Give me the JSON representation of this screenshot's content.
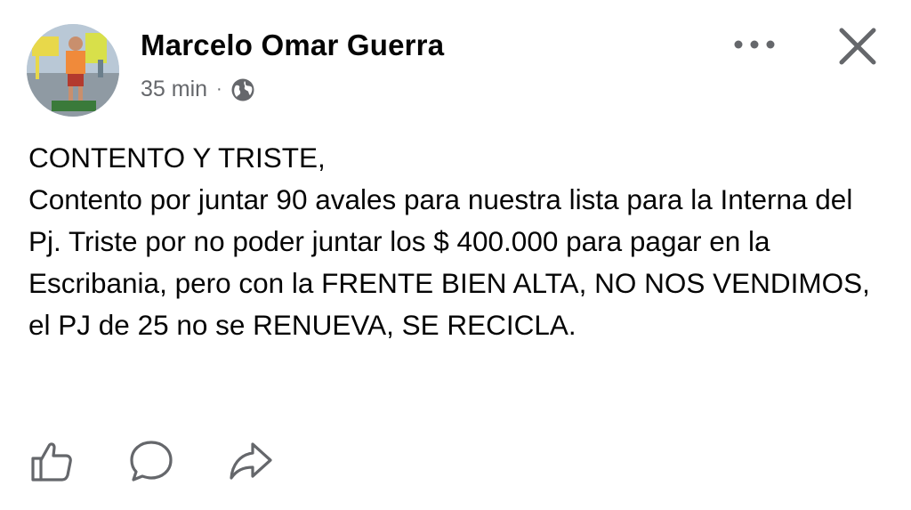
{
  "post": {
    "author_name": "Marcelo Omar Guerra",
    "timestamp": "35 min",
    "separator": "·",
    "privacy_icon": "globe-icon",
    "text": "CONTENTO Y TRISTE,\nContento por juntar 90 avales para nuestra lista para  la Interna del Pj. Triste por no poder juntar los $ 400.000 para pagar en la Escribania, pero con la FRENTE BIEN ALTA, NO NOS VENDIMOS, el PJ de 25 no se RENUEVA, SE RECICLA."
  },
  "header_actions": {
    "more_icon": "more-horizontal-icon",
    "close_icon": "close-icon"
  },
  "footer_actions": [
    {
      "icon": "like-icon"
    },
    {
      "icon": "comment-icon"
    },
    {
      "icon": "share-icon"
    }
  ],
  "colors": {
    "text_primary": "#050505",
    "text_secondary": "#65676b",
    "icon_gray": "#65676b"
  }
}
